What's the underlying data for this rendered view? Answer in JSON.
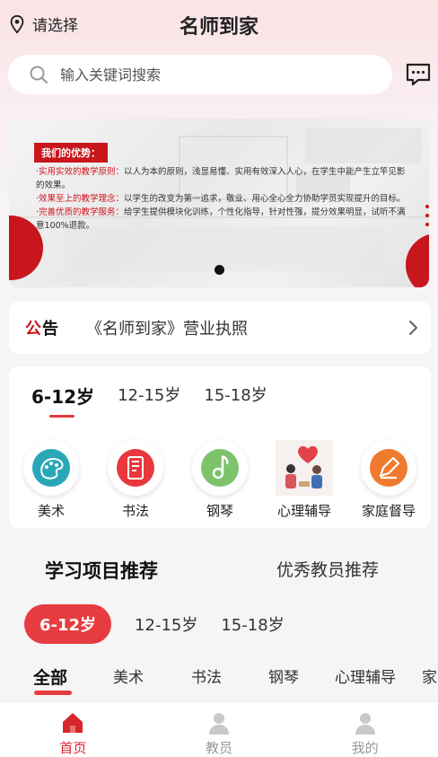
{
  "header": {
    "location_label": "请选择",
    "title": "名师到家"
  },
  "search": {
    "placeholder": "输入关键词搜索"
  },
  "banner": {
    "advantages_title": "我们的优势：",
    "lines": [
      {
        "highlight": "·实用实效的教学原则：",
        "text": "以人为本的原则，浅显易懂、实用有效深入人心，在学生中能产生立竿见影的效果。"
      },
      {
        "highlight": "·效果至上的教学理念：",
        "text": "以学生的改变为第一追求，敬业、用心全心全力协助学员实现提升的目标。"
      },
      {
        "highlight": "·完善优质的教学服务：",
        "text": "给学生提供模块化训练，个性化指导，针对性强，提分效果明显，试听不满意100%退款。"
      }
    ]
  },
  "notice": {
    "tag_part1": "公",
    "tag_part2": "告",
    "text": "《名师到家》营业执照"
  },
  "age_tabs": [
    "6-12岁",
    "12-15岁",
    "15-18岁"
  ],
  "categories": [
    {
      "label": "美术",
      "icon": "palette-icon"
    },
    {
      "label": "书法",
      "icon": "calligraphy-icon"
    },
    {
      "label": "钢琴",
      "icon": "music-note-icon"
    },
    {
      "label": "心理辅导",
      "icon": "counseling-image"
    },
    {
      "label": "家庭督导",
      "icon": "pen-edit-icon"
    }
  ],
  "recommend": {
    "title": "学习项目推荐",
    "alt_title": "优秀教员推荐"
  },
  "pill_tabs": [
    "6-12岁",
    "12-15岁",
    "15-18岁"
  ],
  "sub_tabs": [
    "全部",
    "美术",
    "书法",
    "钢琴",
    "心理辅导",
    "家"
  ],
  "tabbar": [
    {
      "label": "首页",
      "icon": "home-icon"
    },
    {
      "label": "教员",
      "icon": "teacher-icon"
    },
    {
      "label": "我的",
      "icon": "user-icon"
    }
  ],
  "colors": {
    "accent": "#e73c3f",
    "brand_red": "#c8161d"
  }
}
